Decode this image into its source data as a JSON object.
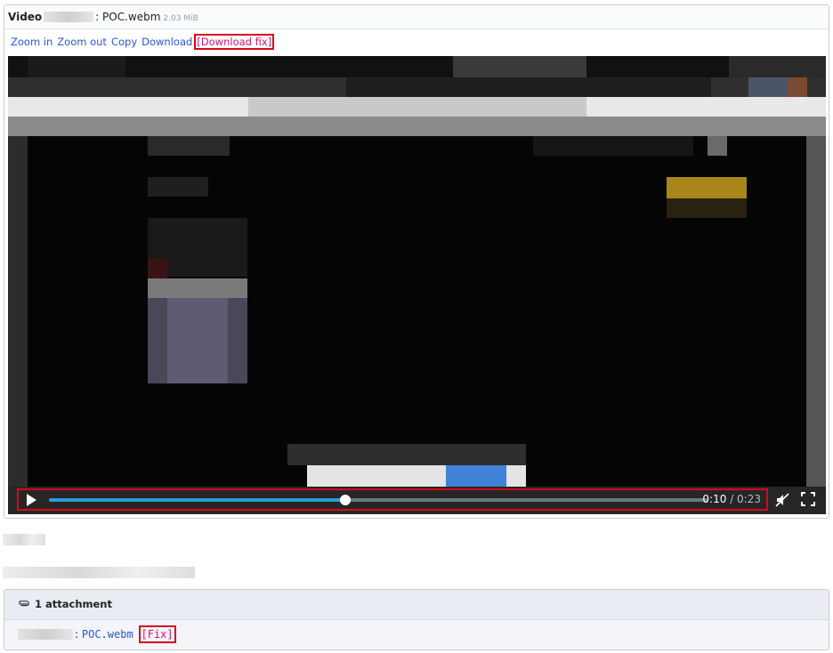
{
  "viewer": {
    "title_prefix": "Video",
    "title_suffix": ": POC.webm",
    "file_size": "2.03 MiB"
  },
  "toolbar": {
    "zoom_in": "Zoom in",
    "zoom_out": "Zoom out",
    "copy": "Copy",
    "download": "Download",
    "download_fix": "[Download fix]"
  },
  "player": {
    "current_time": "0:10",
    "separator": " / ",
    "duration": "0:23",
    "progress": 0.45,
    "colors": {
      "progress": "#2a9bd8",
      "track": "#6b7785",
      "highlight_border": "#d60a17"
    }
  },
  "attachments": {
    "header": "1 attachment",
    "file_name": "POC.webm",
    "separator": ":",
    "fix_label": "[Fix]"
  },
  "icons": {
    "play": "play-icon",
    "mute": "volume-muted-icon",
    "fullscreen": "fullscreen-icon",
    "attachment": "paperclip-icon"
  }
}
